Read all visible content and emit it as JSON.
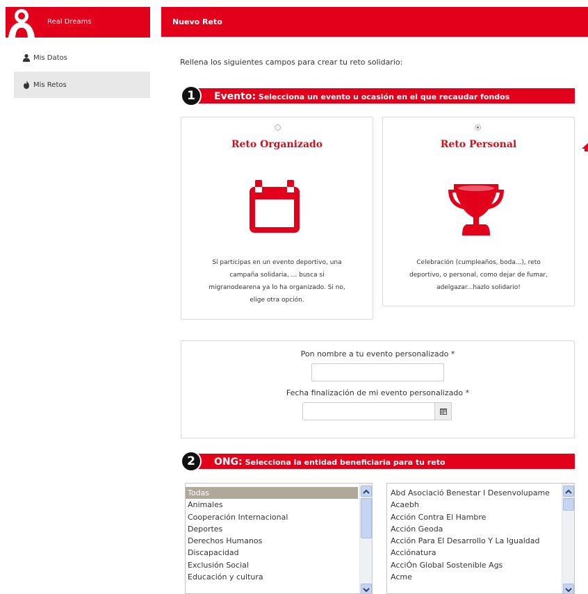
{
  "sidebar": {
    "brand": "Real Dreams",
    "items": [
      {
        "label": "Mis Datos",
        "icon": "user-icon"
      },
      {
        "label": "Mis Retos",
        "icon": "fire-icon"
      }
    ]
  },
  "main": {
    "header": "Nuevo Reto",
    "intro": "Rellena los siguientes campos para crear tu reto solidario:"
  },
  "step1": {
    "number": "1",
    "title_big": "Evento:",
    "title": "Selecciona un evento u ocasión en el que recaudar fondos"
  },
  "cards": {
    "organizado": {
      "title": "Reto Organizado",
      "desc1": "Si participas en un evento deportivo, una",
      "desc2": "campaña solidaria, ... busca si",
      "desc3": "migranodearena ya lo ha organizado. Si no,",
      "desc4": "elige otra opción.",
      "icon": "calendar-icon",
      "selected": false
    },
    "personal": {
      "title": "Reto Personal",
      "desc1": "Celebración (cumpleaños, boda...), reto",
      "desc2": "deportivo, o personal, como dejar de fumar,",
      "desc3": "adelgazar...hazlo solidario!",
      "icon": "trophy-icon",
      "selected": true
    }
  },
  "custom_event": {
    "name_label": "Pon nombre a tu evento personalizado *",
    "name_value": "",
    "date_label": "Fecha finalización de mi evento personalizado *",
    "date_value": ""
  },
  "step2": {
    "number": "2",
    "title_big": "ONG:",
    "title": "Selecciona la entidad beneficiaria para tu reto"
  },
  "categories": [
    "Todas",
    "Animales",
    "Cooperación Internacional",
    "Deportes",
    "Derechos Humanos",
    "Discapacidad",
    "Exclusión Social",
    "Educación y cultura"
  ],
  "ongs": [
    "Abd Asociació Benestar I Desenvolupame",
    "Acaebh",
    "Acción Contra El Hambre",
    "Acción Geoda",
    "Acción Para El Desarrollo Y La Igualdad",
    "Acciónatura",
    "AcciÓn Global Sostenible Ags",
    "Acme"
  ],
  "colors": {
    "brand": "#e2001a",
    "title_red": "#d0111c",
    "selected_row": "#b0a999"
  }
}
